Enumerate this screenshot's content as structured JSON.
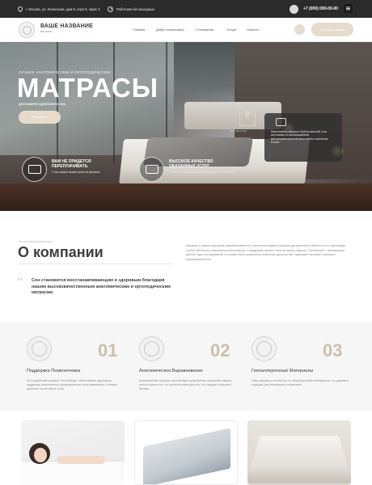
{
  "topbar": {
    "address": "г. Москва, ул. Ленинская, дом 8, корп 8, офис 3",
    "hours": "Работаем без выходных",
    "phone": "+7 (000) 000-00-00"
  },
  "header": {
    "brand_name": "ВАШЕ НАЗВАНИЕ",
    "brand_slogan": "матрасы",
    "nav": [
      "Главная",
      "Добро пожаловать",
      "О компании",
      "Услуги",
      "Новости"
    ],
    "cta_label": "Оставить заявку"
  },
  "hero": {
    "subtitle": "ЛУЧШИЕ АНАТОМИЧЕСКИЕ И ОРТОПЕДИЧЕСКИЕ",
    "title": "МАТРАСЫ",
    "under_title": "для вашего идеального сна",
    "button": "Подробнее",
    "features": [
      {
        "title": "ВАМ НЕ ПРИДЕТСЯ ПЕРЕПЛАЧИВАТЬ",
        "desc": "У нас самые низкие цены на матрасы"
      },
      {
        "title": "ВЫСОКОЕ КАЧЕСТВО ОКАЗАННЫХ УСЛУГ",
        "desc": "Только сертифицированные продукты и материалы"
      }
    ],
    "brand_plate": "P",
    "brand_plate_text": "TAXSEILES",
    "info_card": "Наполнитель матраса Topfera высотой 4 см изготовлен из инновационной высококачественной пены нового поколения Evoset"
  },
  "about": {
    "kicker": "Матрасная мануфактура",
    "title": "О компании",
    "quote": "Сон становится восстанавливающим и здоровым благодаря нашим высококачественным анатомическим и ортопедическим матрасам.",
    "body": "Каждый из наших матрасов разрабатывается с учетом последних научных достижений в области сна и ортопедии, чтобы обеспечить максимальный комфорт и поддержку вашего тела во время отдыха. Стремление к инновациям, долгие годы исследований и отзывы тысяч довольных клиентов сделали нас лидерами на рынке спальных принадлежностей."
  },
  "benefits": [
    {
      "num": "01",
      "title": "Поддержка Позвоночника",
      "desc": "Ортопедические матрасы \"DreamRidge\" обеспечивают идеальную поддержку позвоночника, распределяя вес тела равномерно и снижая давление на ключевые точки."
    },
    {
      "num": "02",
      "title": "Анатомическое Выравнивание",
      "desc": "Анатомические матрасы способствуют правильному положению вашего тела во время сна, что особенно важно для тех, кто страдает спинными болями."
    },
    {
      "num": "03",
      "title": "Гипоаллергенные Материалы",
      "desc": "Наши матрасы изготовлены из гипоаллергенных материалов, что идеально подходит для аллергиков и астматиков."
    }
  ]
}
